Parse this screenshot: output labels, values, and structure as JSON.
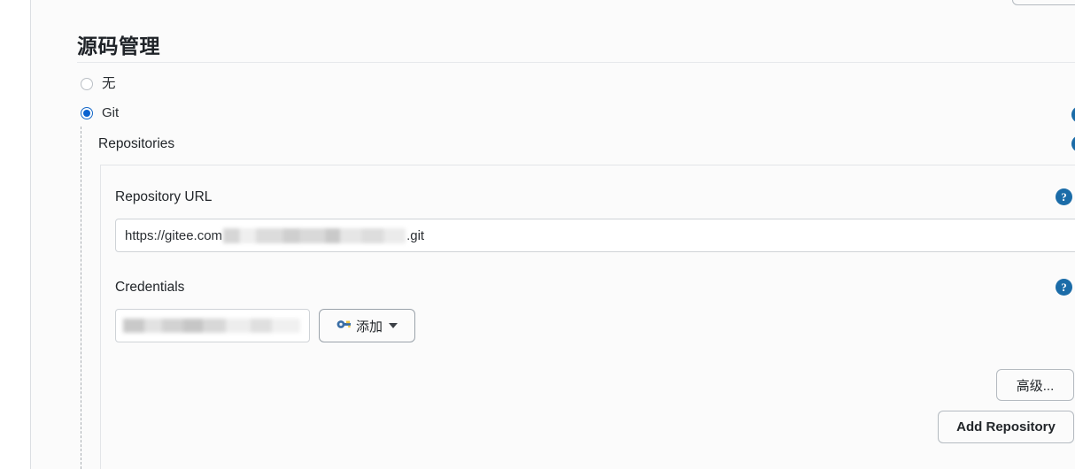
{
  "section": {
    "title": "源码管理"
  },
  "scm_options": [
    {
      "label": "无",
      "value": "none",
      "checked": false
    },
    {
      "label": "Git",
      "value": "git",
      "checked": true
    }
  ],
  "repositories": {
    "group_label": "Repositories",
    "repository_url": {
      "label": "Repository URL",
      "value_prefix": "https://gitee.com",
      "value_redacted": true,
      "value_suffix": ".git"
    },
    "credentials": {
      "label": "Credentials",
      "selected_value_redacted": true,
      "add_button": {
        "label": "添加",
        "icon": "key-icon",
        "caret": "chevron-down-icon"
      }
    },
    "advanced_button": "高级...",
    "add_repository_button": "Add Repository"
  },
  "help_icons": {
    "glyph": "?",
    "count": 4,
    "color": "#1b6ca8"
  },
  "colors": {
    "accent_radio": "#0a62d0",
    "help_blue": "#1b6ca8",
    "panel_bg": "#fbfbfb",
    "border": "#e3e5e8",
    "text": "#22262a"
  }
}
